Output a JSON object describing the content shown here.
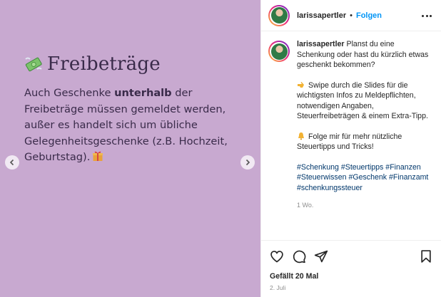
{
  "slide": {
    "title": "Freibeträge",
    "emoji_icon": "money-with-wings-icon",
    "body_pre": "Auch Geschenke ",
    "body_strong": "unterhalb",
    "body_post": " der Freibeträge müssen gemeldet werden, außer es handelt sich um übliche Gelegenheitsgeschenke (z.B. Hochzeit, Geburtstag).",
    "body_end_icon": "gift-icon",
    "background": "#c8a9d0",
    "text_color": "#3a2b4a"
  },
  "header": {
    "username": "larissapertler",
    "separator": "•",
    "follow_label": "Folgen"
  },
  "caption": {
    "username": "larissapertler",
    "text1": "Planst du eine Schenkung oder hast du kürzlich etwas geschenkt bekommen?",
    "text2": "Swipe durch die Slides für die wichtigsten Infos zu Meldepflichten, notwendigen Angaben, Steuerfreibeträgen & einem Extra-Tipp.",
    "text2_icon": "pointing-hand-icon",
    "text3": "Folge mir für mehr nützliche Steuertipps und Tricks!",
    "text3_icon": "bell-icon",
    "hashtags": [
      "#Schenkung",
      "#Steuertipps",
      "#Finanzen",
      "#Steuerwissen",
      "#Geschenk",
      "#Finanzamt",
      "#schenkungssteuer"
    ],
    "time_ago": "1 Wo."
  },
  "footer": {
    "likes": "Gefällt 20 Mal",
    "date": "2. Juli"
  },
  "colors": {
    "link": "#0095f6",
    "hashtag": "#00376b",
    "muted": "#8e8e8e"
  }
}
